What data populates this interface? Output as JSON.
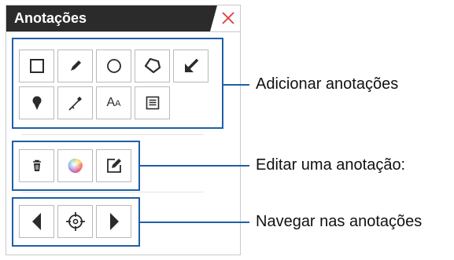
{
  "panel": {
    "title": "Anotações",
    "close_icon": "close-x-icon"
  },
  "groups": {
    "add": {
      "tools": [
        {
          "name": "rectangle-tool",
          "icon": "square-outline"
        },
        {
          "name": "pencil-tool",
          "icon": "pencil"
        },
        {
          "name": "ellipse-tool",
          "icon": "circle-outline"
        },
        {
          "name": "polygon-tool",
          "icon": "polygon-outline"
        },
        {
          "name": "arrow-tool",
          "icon": "arrow-down-left"
        },
        {
          "name": "pin-tool",
          "icon": "map-pin"
        },
        {
          "name": "measure-tool",
          "icon": "ruler-needle"
        },
        {
          "name": "text-tool",
          "icon": "text-aa",
          "label_big": "A",
          "label_small": "A"
        },
        {
          "name": "note-tool",
          "icon": "note-lines"
        }
      ]
    },
    "edit": {
      "tools": [
        {
          "name": "delete-annotation",
          "icon": "trash"
        },
        {
          "name": "color-annotation",
          "icon": "color-wheel"
        },
        {
          "name": "edit-annotation",
          "icon": "edit-box-pencil"
        }
      ]
    },
    "navigate": {
      "tools": [
        {
          "name": "previous-annotation",
          "icon": "triangle-left"
        },
        {
          "name": "center-annotation",
          "icon": "crosshair"
        },
        {
          "name": "next-annotation",
          "icon": "triangle-right"
        }
      ]
    }
  },
  "callouts": {
    "add": "Adicionar anotações",
    "edit": "Editar uma anotação:",
    "navigate": "Navegar nas anotações"
  },
  "colors": {
    "accent_blue": "#1f5fa8",
    "title_bg": "#2b2b2b",
    "close_red": "#e0393e",
    "icon_dark": "#2b2b2b"
  }
}
